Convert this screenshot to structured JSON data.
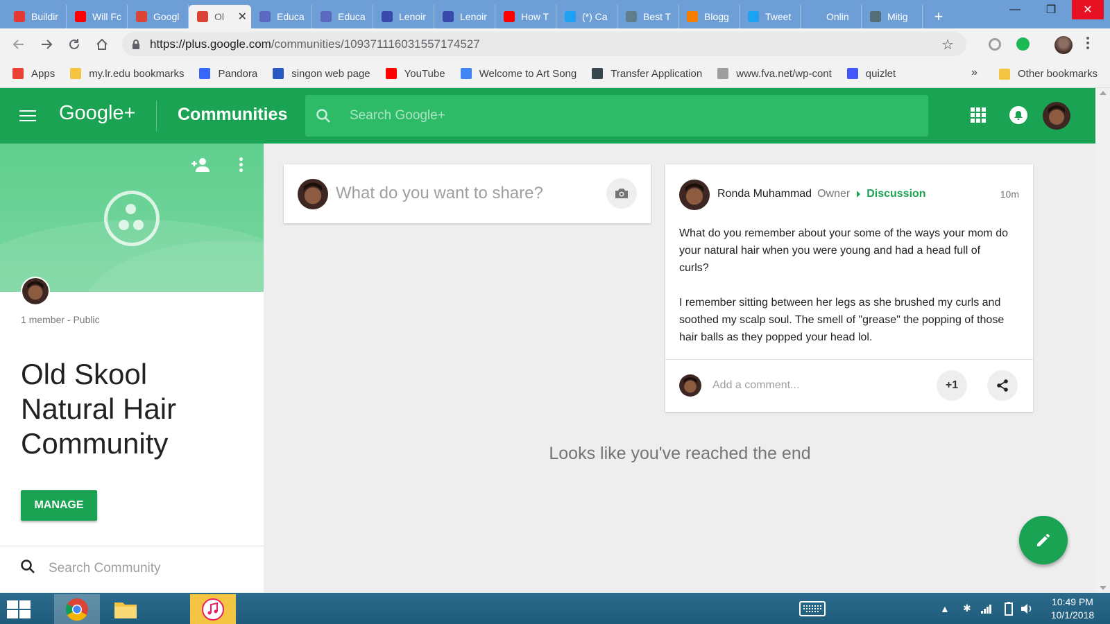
{
  "browser": {
    "tabs": [
      {
        "title": "Buildir",
        "icon": "target-icon",
        "color": "#e53935"
      },
      {
        "title": "Will Fc",
        "icon": "youtube-icon",
        "color": "#ff0000"
      },
      {
        "title": "Googl",
        "icon": "google-plus-icon",
        "color": "#db4437"
      },
      {
        "title": "Ol",
        "icon": "google-plus-icon",
        "color": "#db4437",
        "active": true
      },
      {
        "title": "Educa",
        "icon": "doc-icon",
        "color": "#5c6bc0"
      },
      {
        "title": "Educa",
        "icon": "doc-icon",
        "color": "#5c6bc0"
      },
      {
        "title": "Lenoir",
        "icon": "calendar-icon",
        "color": "#3949ab"
      },
      {
        "title": "Lenoir",
        "icon": "calendar-icon",
        "color": "#3949ab"
      },
      {
        "title": "How T",
        "icon": "youtube-icon",
        "color": "#ff0000"
      },
      {
        "title": "(*) Ca",
        "icon": "twitter-icon",
        "color": "#1da1f2"
      },
      {
        "title": "Best T",
        "icon": "image-icon",
        "color": "#607d8b"
      },
      {
        "title": "Blogg",
        "icon": "blogger-icon",
        "color": "#f57d00"
      },
      {
        "title": "Tweet",
        "icon": "twitter-icon",
        "color": "#1da1f2"
      },
      {
        "title": "Onlin",
        "icon": "blank-icon",
        "color": "#6d9fd6"
      },
      {
        "title": "Mitig",
        "icon": "search-person-icon",
        "color": "#546e7a"
      }
    ],
    "new_tab_label": "+",
    "tab_close": "✕",
    "url_host": "https://plus.google.com",
    "url_path": "/communities/109371116031557174527",
    "window_controls": {
      "minimize": "—",
      "restore": "❐",
      "close": "✕"
    }
  },
  "bookmarks": [
    {
      "label": "Apps",
      "icon": "apps-grid-icon",
      "color": "#ea4335"
    },
    {
      "label": "my.lr.edu bookmarks",
      "icon": "folder-icon",
      "color": "#f4c542"
    },
    {
      "label": "Pandora",
      "icon": "pandora-icon",
      "color": "#3668ff"
    },
    {
      "label": "singon web page",
      "icon": "x-logo-icon",
      "color": "#2b59c3"
    },
    {
      "label": "YouTube",
      "icon": "youtube-icon",
      "color": "#ff0000"
    },
    {
      "label": "Welcome to Art Song",
      "icon": "google-icon",
      "color": "#4285f4"
    },
    {
      "label": "Transfer Application",
      "icon": "shield-icon",
      "color": "#37474f"
    },
    {
      "label": "www.fva.net/wp-cont",
      "icon": "page-icon",
      "color": "#9e9e9e"
    },
    {
      "label": "quizlet",
      "icon": "quizlet-icon",
      "color": "#4255ff"
    }
  ],
  "bookmarks_overflow": "»",
  "other_bookmarks": "Other bookmarks",
  "gplus": {
    "logo": "Google+",
    "section": "Communities",
    "search_placeholder": "Search Google+"
  },
  "community": {
    "meta": "1 member - Public",
    "name": "Old Skool Natural Hair Community",
    "manage_label": "MANAGE",
    "search_placeholder": "Search Community"
  },
  "share_box": {
    "placeholder": "What do you want to share?"
  },
  "post": {
    "author": "Ronda Muhammad",
    "role": "Owner",
    "category": "Discussion",
    "time": "10m",
    "paragraphs": [
      "What do you remember about your some of the ways your mom do your natural hair when you were young and had a head full of curls?",
      "I remember sitting between her legs as she brushed my curls and soothed my scalp soul. The smell of \"grease\" the popping of those hair balls as they popped your head lol."
    ],
    "comment_placeholder": "Add a comment...",
    "plus_one": "+1"
  },
  "end_message": "Looks like you've reached the end",
  "taskbar": {
    "time": "10:49 PM",
    "date": "10/1/2018"
  },
  "colors": {
    "brand_green": "#1aa353",
    "search_green": "#2ebb67",
    "tab_strip": "#6d9fd6"
  }
}
